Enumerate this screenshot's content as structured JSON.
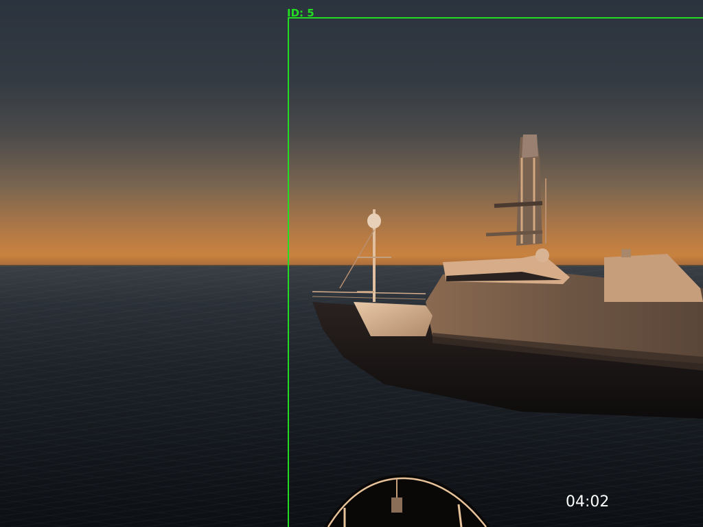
{
  "detection": {
    "label": "ID: 5",
    "color": "#22dd22"
  },
  "hud": {
    "timer": "04:02"
  },
  "scene": {
    "sky_top_color": "#2b333e",
    "sunset_color": "#c9823f",
    "sea_color": "#14181d"
  }
}
